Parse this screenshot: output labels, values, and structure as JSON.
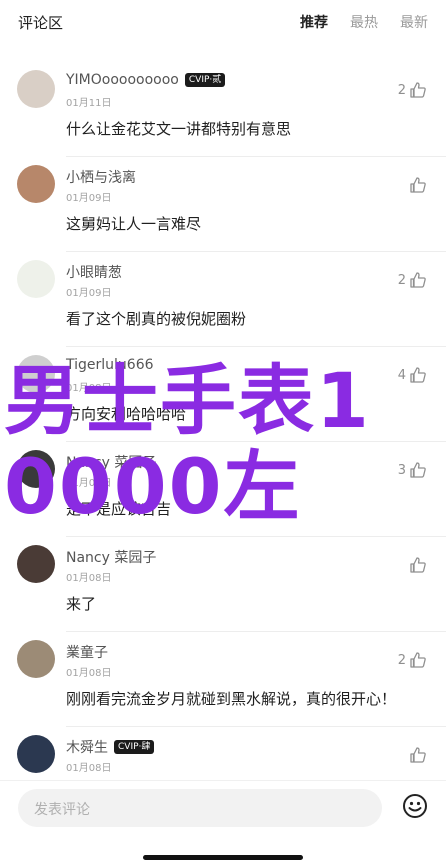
{
  "header": {
    "title": "评论区",
    "tabs": [
      {
        "label": "推荐",
        "active": true
      },
      {
        "label": "最热",
        "active": false
      },
      {
        "label": "最新",
        "active": false
      }
    ]
  },
  "comments": [
    {
      "name": "YIMOooooooooo",
      "vip": "CVIP·贰",
      "date": "01月11日",
      "text": "什么让金花艾文一讲都特别有意思",
      "likes": "2",
      "avatar_color": "#d9cfc6"
    },
    {
      "name": "小栖与浅离",
      "vip": "",
      "date": "01月09日",
      "text": "这舅妈让人一言难尽",
      "likes": "",
      "avatar_color": "#b7876a"
    },
    {
      "name": "小眼睛葱",
      "vip": "",
      "date": "01月09日",
      "text": "看了这个剧真的被倪妮圈粉",
      "likes": "2",
      "avatar_color": "#eef1ea"
    },
    {
      "name": "Tigerlulu666",
      "vip": "",
      "date": "01月08日",
      "text": "方向安利哈哈哈哈",
      "likes": "4",
      "avatar_color": "#cfcfcf"
    },
    {
      "name": "Nancy 菜园子",
      "vip": "",
      "date": "01月08日",
      "text": "是不是应该吉吉",
      "likes": "3",
      "avatar_color": "#3a3a3a"
    },
    {
      "name": "Nancy 菜园子",
      "vip": "",
      "date": "01月08日",
      "text": "来了",
      "likes": "",
      "avatar_color": "#4a3b36"
    },
    {
      "name": "業童子",
      "vip": "",
      "date": "01月08日",
      "text": "刚刚看完流金岁月就碰到黑水解说，真的很开心！",
      "likes": "2",
      "avatar_color": "#9c8b76"
    },
    {
      "name": "木舜生",
      "vip": "CVIP·肆",
      "date": "01月08日",
      "text": "",
      "likes": "",
      "avatar_color": "#2b3850"
    }
  ],
  "overlay": {
    "line1": "男士手表1",
    "line2": "0000左"
  },
  "input": {
    "placeholder": "发表评论"
  },
  "icons": {
    "like": "thumbs-up-icon",
    "emoji": "smile-emoji-icon"
  }
}
